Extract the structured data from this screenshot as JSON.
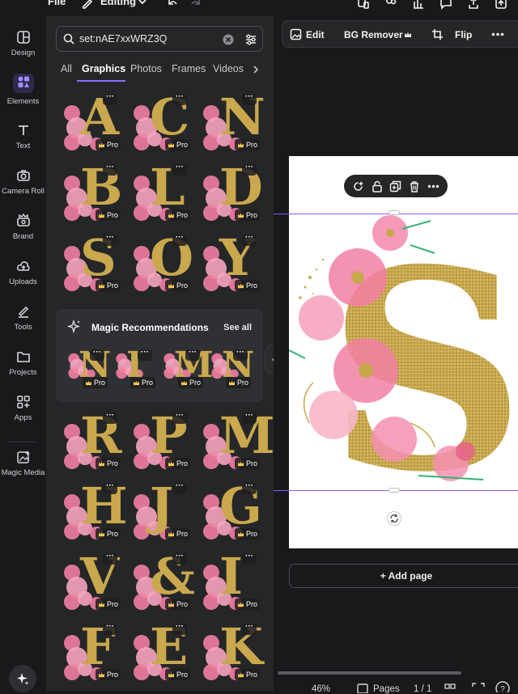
{
  "topbar": {
    "file_label": "File",
    "editing_label": "Editing"
  },
  "rail": {
    "items": [
      {
        "label": "Design",
        "icon": "design-icon"
      },
      {
        "label": "Elements",
        "icon": "elements-icon"
      },
      {
        "label": "Text",
        "icon": "text-icon"
      },
      {
        "label": "Camera Roll",
        "icon": "camera-icon"
      },
      {
        "label": "Brand",
        "icon": "brand-icon"
      },
      {
        "label": "Uploads",
        "icon": "upload-icon"
      },
      {
        "label": "Tools",
        "icon": "tools-icon"
      },
      {
        "label": "Projects",
        "icon": "folder-icon"
      },
      {
        "label": "Apps",
        "icon": "apps-icon"
      },
      {
        "label": "Magic Media",
        "icon": "magic-media-icon"
      }
    ]
  },
  "search": {
    "value": "set:nAE7xxWRZ3Q"
  },
  "tabs": [
    "All",
    "Graphics",
    "Photos",
    "Frames",
    "Videos"
  ],
  "grid_top": {
    "letters": [
      "A",
      "C",
      "N",
      "B",
      "L",
      "D",
      "S",
      "O",
      "Y"
    ],
    "badge": "Pro"
  },
  "magic": {
    "title": "Magic Recommendations",
    "see_all": "See all",
    "letters": [
      "N",
      "I",
      "M",
      "N"
    ],
    "badge": "Pro"
  },
  "grid_bottom": {
    "letters": [
      "R",
      "P",
      "M",
      "H",
      "J",
      "G",
      "V",
      "&",
      "I",
      "F",
      "E",
      "K"
    ],
    "badge": "Pro"
  },
  "context_bar": {
    "edit_label": "Edit",
    "bg_remover_label": "BG Remover",
    "flip_label": "Flip"
  },
  "canvas": {
    "add_page_label": "+ Add page",
    "letter": "S"
  },
  "bottombar": {
    "zoom": "46%",
    "pages_label": "Pages",
    "page_count": "1 / 1"
  },
  "colors": {
    "accent": "#8b6cff",
    "gold": "#c9a84e",
    "pink": "#f27fa3"
  }
}
